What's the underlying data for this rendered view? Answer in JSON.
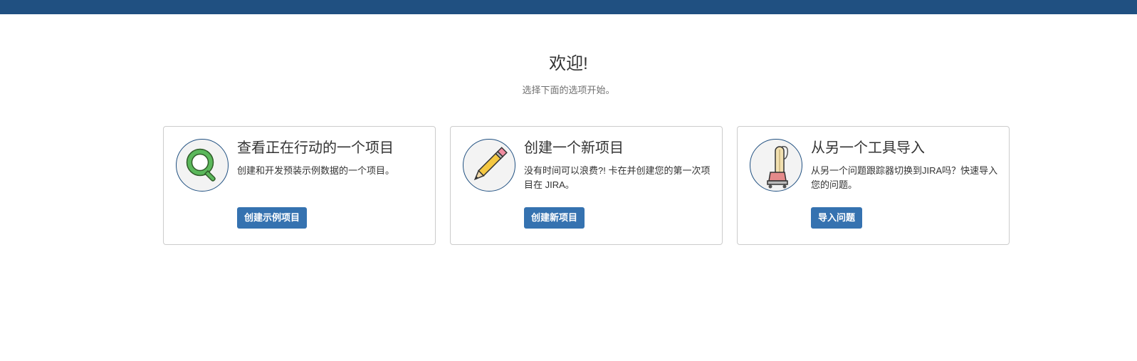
{
  "header": {
    "title": "欢迎!",
    "subtitle": "选择下面的选项开始。"
  },
  "colors": {
    "topbar": "#205081",
    "button": "#3572b0"
  },
  "cards": [
    {
      "icon": "magnifier-icon",
      "title": "查看正在行动的一个项目",
      "description": "创建和开发预装示例数据的一个项目。",
      "button_label": "创建示例项目"
    },
    {
      "icon": "pencil-icon",
      "title": "创建一个新项目",
      "description": "没有时间可以浪费?! 卡在并创建您的第一次项目在 JIRA。",
      "button_label": "创建新项目"
    },
    {
      "icon": "vacuum-icon",
      "title": "从另一个工具导入",
      "description": "从另一个问题跟踪器切换到JIRA吗？快速导入您的问题。",
      "button_label": "导入问题"
    }
  ]
}
